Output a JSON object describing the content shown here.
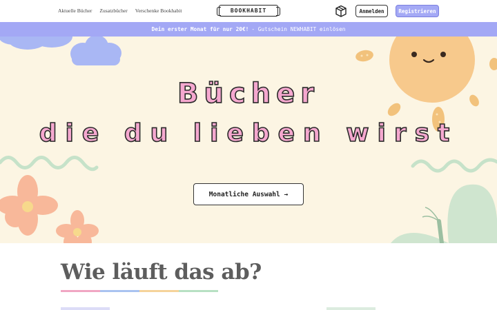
{
  "header": {
    "nav": [
      "Aktuelle Bücher",
      "Zusatzbücher",
      "Verschenke Bookhabit"
    ],
    "logo": "BOOKHABIT",
    "login_label": "Anmelden",
    "register_label": "Registrieren"
  },
  "promo": {
    "bold": "Dein erster Monat für nur 20€!",
    "rest": "- Gutschein NEWHABIT einlösen"
  },
  "hero": {
    "line1": "Bücher",
    "line2": "die du lieben wirst",
    "cta": "Monatliche Auswahl →"
  },
  "section": {
    "title": "Wie läuft das ab?"
  },
  "colors": {
    "accent": "#a3a8f5",
    "hero_bg": "#fcf5e3",
    "headline_fill": "#f5a8cf",
    "underline": [
      "#f0a6c3",
      "#a9c3f0",
      "#f5d39a",
      "#b7e0c3"
    ]
  },
  "icons": [
    "box-icon",
    "sun-icon",
    "cloud-icon",
    "flower-icon",
    "butterfly-icon"
  ]
}
